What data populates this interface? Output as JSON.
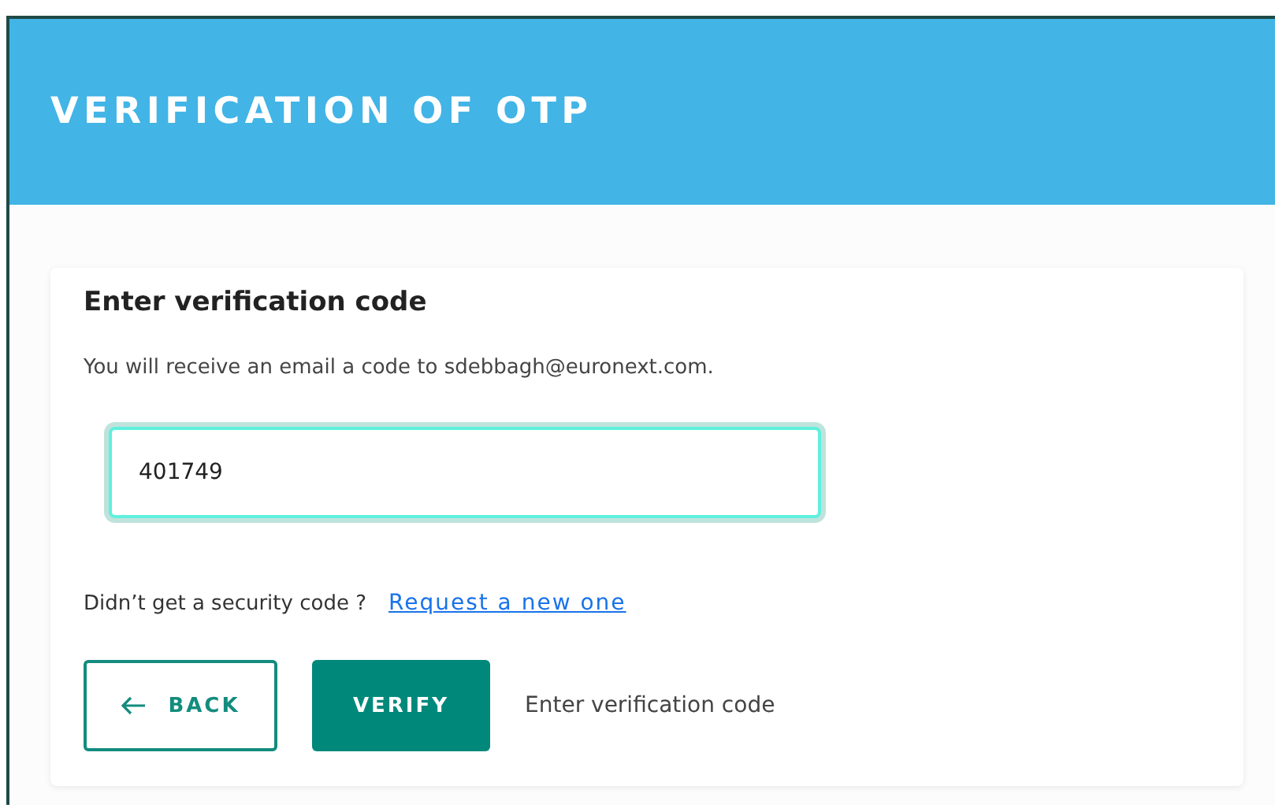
{
  "header": {
    "title": "VERIFICATION OF OTP"
  },
  "card": {
    "heading": "Enter verification code",
    "info": "You will receive an email a code to sdebbagh@euronext.com.",
    "code_field": {
      "value": "401749",
      "focused": true
    },
    "resend_prompt": "Didn’t get a security code ?",
    "resend_link": "Request a new one",
    "back_button": "BACK",
    "verify_button": "VERIFY",
    "hint": "Enter verification code"
  }
}
